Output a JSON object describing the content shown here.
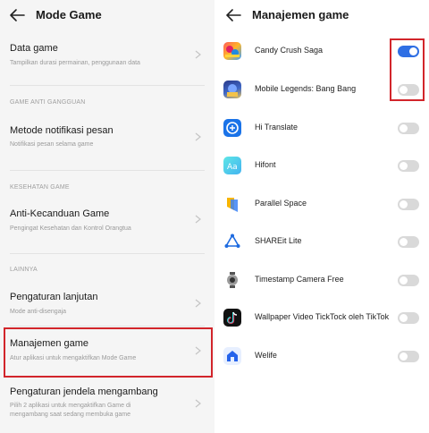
{
  "left": {
    "title": "Mode Game",
    "rows": [
      {
        "title": "Data game",
        "subtitle": "Tampilkan durasi permainan, penggunaan data"
      },
      {
        "section": "GAME ANTI GANGGUAN"
      },
      {
        "title": "Metode notifikasi pesan",
        "subtitle": "Notifikasi pesan selama game"
      },
      {
        "section": "KESEHATAN GAME"
      },
      {
        "title": "Anti-Kecanduan Game",
        "subtitle": "Pengingat Kesehatan dan Kontrol Orangtua"
      },
      {
        "section": "LAINNYA"
      },
      {
        "title": "Pengaturan lanjutan",
        "subtitle": "Mode anti-disengaja"
      },
      {
        "title": "Manajemen game",
        "subtitle": "Atur aplikasi untuk mengaktifkan Mode Game"
      },
      {
        "title": "Pengaturan jendela mengambang",
        "subtitle1": "Pilih 2 aplikasi untuk mengaktifkan Game di",
        "subtitle2": "mengambang saat sedang membuka game"
      }
    ]
  },
  "right": {
    "title": "Manajemen game",
    "apps": [
      {
        "name": "Candy Crush Saga",
        "enabled": true,
        "icon": "candy-crush-icon"
      },
      {
        "name": "Mobile Legends: Bang Bang",
        "enabled": false,
        "icon": "mobile-legends-icon"
      },
      {
        "name": "Hi Translate",
        "enabled": false,
        "icon": "hi-translate-icon"
      },
      {
        "name": "Hifont",
        "enabled": false,
        "icon": "hifont-icon"
      },
      {
        "name": "Parallel Space",
        "enabled": false,
        "icon": "parallel-space-icon"
      },
      {
        "name": "SHAREit Lite",
        "enabled": false,
        "icon": "shareit-lite-icon"
      },
      {
        "name": "Timestamp Camera Free",
        "enabled": false,
        "icon": "timestamp-camera-icon"
      },
      {
        "name": "Wallpaper Video TickTock oleh TikTok",
        "enabled": false,
        "icon": "tiktok-wallpaper-icon"
      },
      {
        "name": "Welife",
        "enabled": false,
        "icon": "welife-icon"
      }
    ]
  },
  "colors": {
    "accent": "#2f6fe4",
    "highlight": "#d2252b",
    "toggle_off": "#d9d9d9"
  }
}
